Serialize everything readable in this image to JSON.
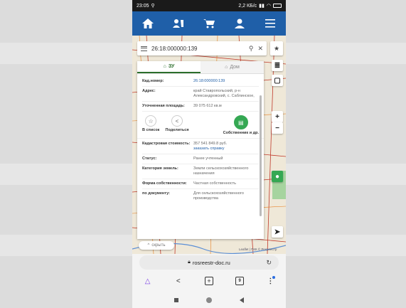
{
  "status_bar": {
    "time": "23:05",
    "network": "2,2 КБ/с",
    "battery": "83"
  },
  "nav": {
    "items": [
      "home-icon",
      "map-user-icon",
      "cart-icon",
      "user-icon",
      "menu-icon"
    ]
  },
  "search": {
    "query": "26:18:000000:139"
  },
  "card": {
    "tabs": [
      {
        "label": "ЗУ",
        "active": true
      },
      {
        "label": "Дом",
        "active": false
      }
    ],
    "rows_top": [
      {
        "key": "Кад.номер:",
        "value": "26:18:000000:139",
        "link": true
      },
      {
        "key": "Адрес:",
        "value": "край Ставропольский, р-н Александровский, с. Саблинское,",
        "link": false
      },
      {
        "key": "Уточненная площадь:",
        "value": "39 075 612 кв.м",
        "link": false
      }
    ],
    "actions": [
      {
        "label": "В список"
      },
      {
        "label": "Поделиться"
      },
      {
        "label": "Собственник и др."
      }
    ],
    "cost": {
      "key": "Кадастровая стоимость:",
      "value": "357 541 849.8 руб.",
      "link_text": "заказать справку"
    },
    "rows_bottom": [
      {
        "key": "Статус:",
        "value": "Ранее учтенный"
      },
      {
        "key": "Категория земель:",
        "value": "Земли сельскохозяйственного назначения"
      },
      {
        "key": "Форма собственности:",
        "value": "Частная собственность"
      },
      {
        "key": "по документу:",
        "value": "Для сельскохозяйственного производства"
      }
    ]
  },
  "map": {
    "hide_label": "скрыть",
    "attribution": "Leaflet | ПКК © Росреестр"
  },
  "browser": {
    "url": "rosreestr-doc.ru",
    "tab_count": "9"
  }
}
